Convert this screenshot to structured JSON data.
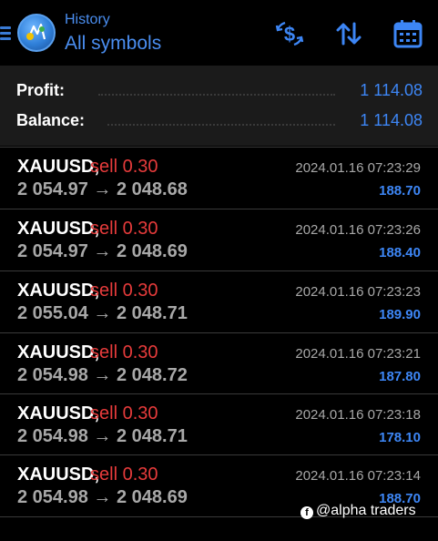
{
  "header": {
    "subtitle": "History",
    "title": "All symbols",
    "menu_icon": "menu-icon",
    "logo_icon": "metatrader-logo-icon",
    "buttons": [
      {
        "name": "currency-switch-icon"
      },
      {
        "name": "sort-icon"
      },
      {
        "name": "calendar-icon"
      }
    ],
    "accent": "#4a8ef0"
  },
  "summary": {
    "profit_label": "Profit:",
    "profit_value": "1 114.08",
    "balance_label": "Balance:",
    "balance_value": "1 114.08"
  },
  "colors": {
    "sell": "#e63b3b",
    "profit": "#3d86f5",
    "muted": "#a8a8a8"
  },
  "trades": [
    {
      "symbol": "XAUUSD,",
      "side": "sell 0.30",
      "prices": "2 054.97 → 2 048.68",
      "time": "2024.01.16 07:23:29",
      "profit": "188.70"
    },
    {
      "symbol": "XAUUSD,",
      "side": "sell 0.30",
      "prices": "2 054.97 → 2 048.69",
      "time": "2024.01.16 07:23:26",
      "profit": "188.40"
    },
    {
      "symbol": "XAUUSD,",
      "side": "sell 0.30",
      "prices": "2 055.04 → 2 048.71",
      "time": "2024.01.16 07:23:23",
      "profit": "189.90"
    },
    {
      "symbol": "XAUUSD,",
      "side": "sell 0.30",
      "prices": "2 054.98 → 2 048.72",
      "time": "2024.01.16 07:23:21",
      "profit": "187.80"
    },
    {
      "symbol": "XAUUSD,",
      "side": "sell 0.30",
      "prices": "2 054.98 → 2 048.71",
      "time": "2024.01.16 07:23:18",
      "profit": "178.10"
    },
    {
      "symbol": "XAUUSD,",
      "side": "sell 0.30",
      "prices": "2 054.98 → 2 048.69",
      "time": "2024.01.16 07:23:14",
      "profit": "188.70"
    }
  ],
  "watermark": {
    "icon": "facebook-icon",
    "text": "@alpha traders"
  }
}
